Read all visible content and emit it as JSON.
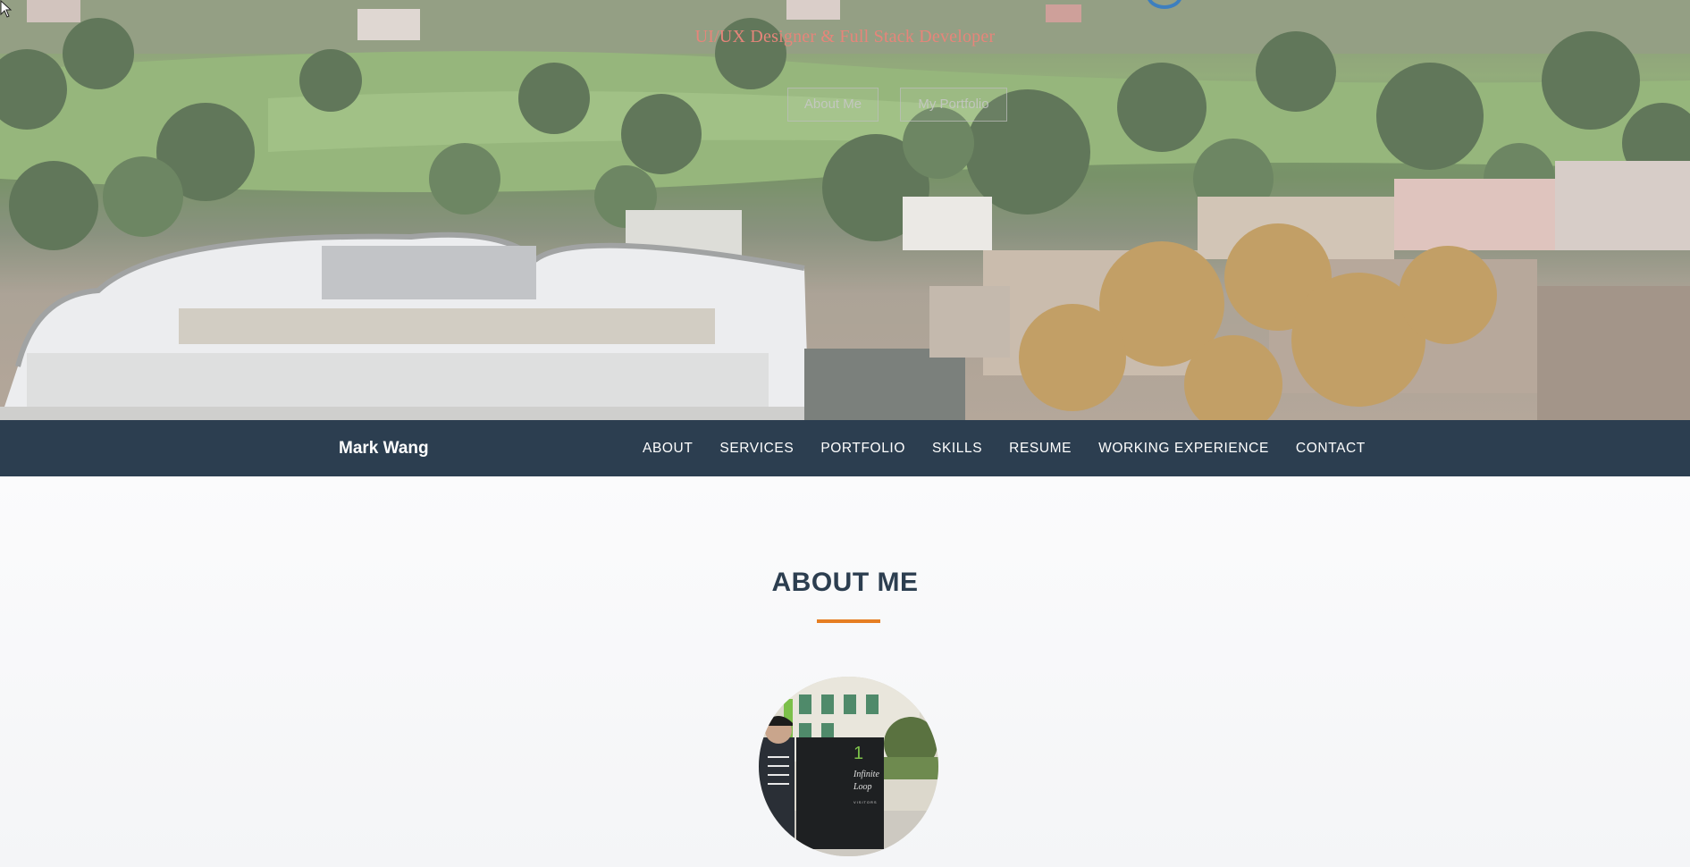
{
  "hero": {
    "subtitle": "UI/UX Designer & Full Stack Developer",
    "buttons": {
      "about": "About Me",
      "portfolio": "My Portfolio"
    }
  },
  "navbar": {
    "brand": "Mark Wang",
    "links": [
      "ABOUT",
      "SERVICES",
      "PORTFOLIO",
      "SKILLS",
      "RESUME",
      "WORKING EXPERIENCE",
      "CONTACT"
    ]
  },
  "about": {
    "title": "ABOUT ME",
    "avatar_sign": {
      "number": "1",
      "line1": "Infinite",
      "line2": "Loop",
      "line3": "VISITORS"
    }
  },
  "colors": {
    "navbar_bg": "#2c3e50",
    "accent": "#e67e22",
    "title": "#2c3e50",
    "subtitle": "#e6857a"
  }
}
